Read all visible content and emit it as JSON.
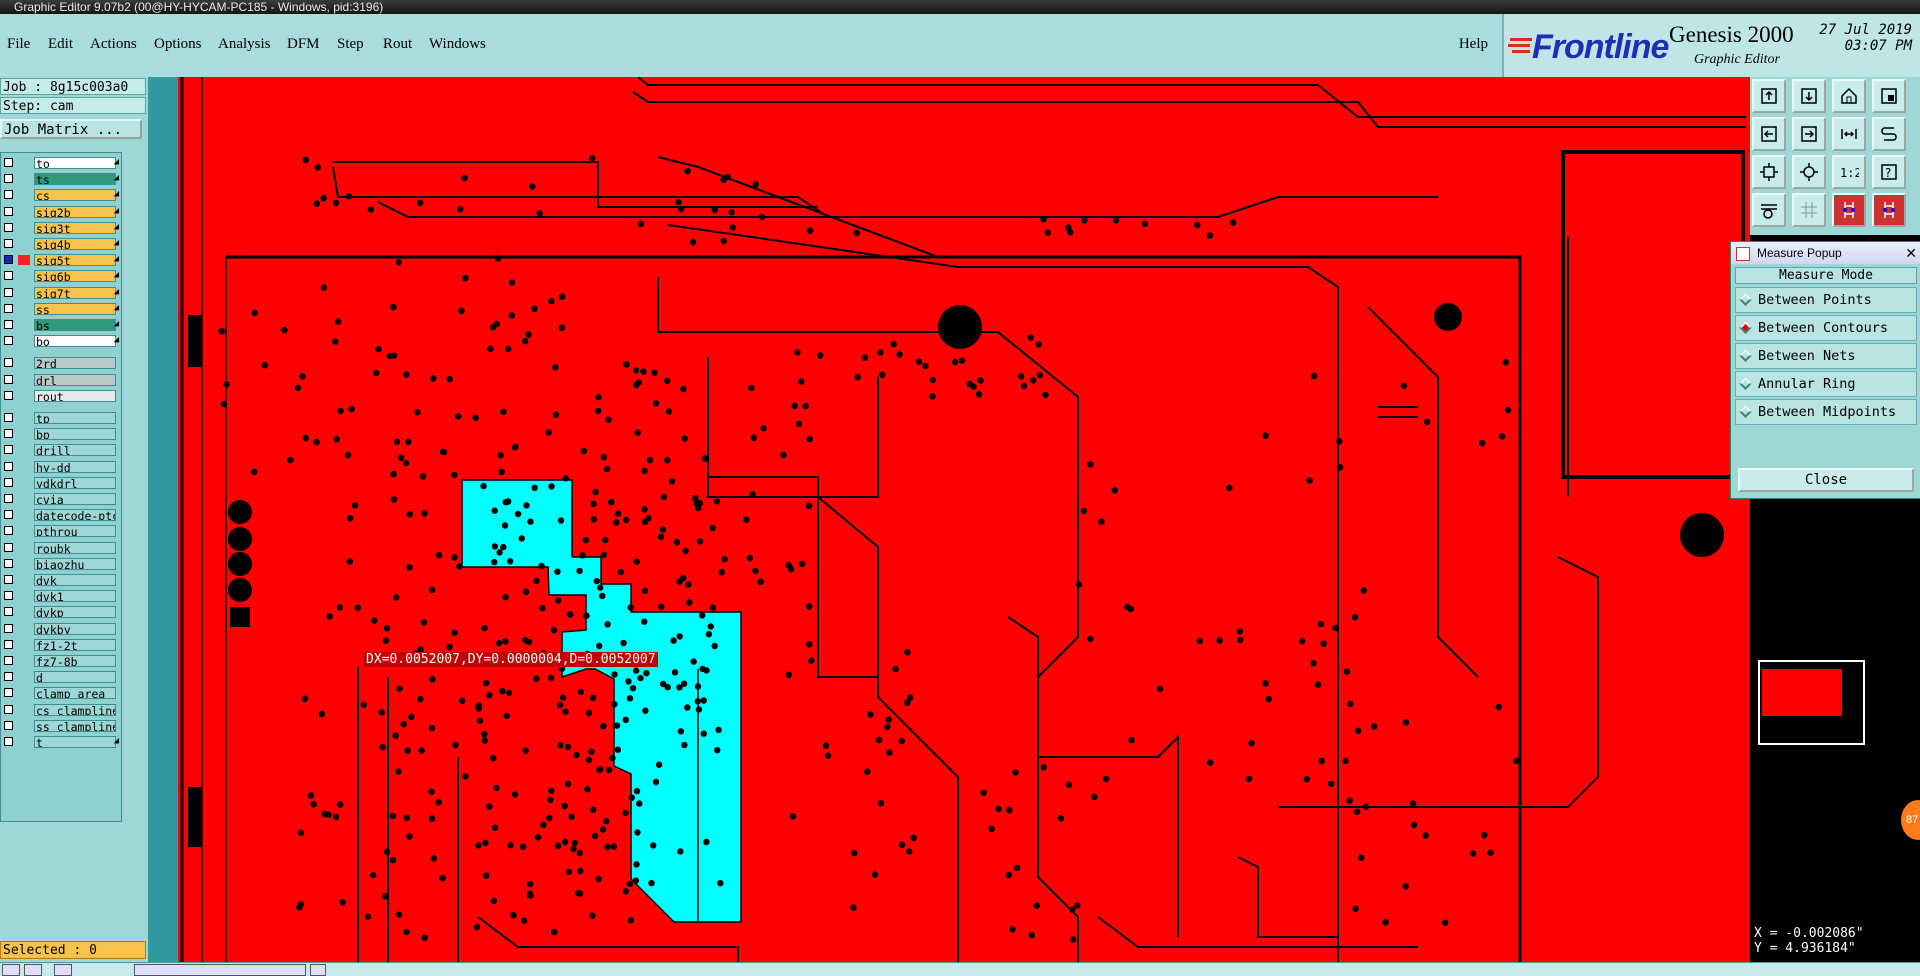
{
  "window": {
    "title": "Graphic Editor 9.07b2 (00@HY-HYCAM-PC185 - Windows, pid:3196)"
  },
  "menu": {
    "items": [
      "File",
      "Edit",
      "Actions",
      "Options",
      "Analysis",
      "DFM",
      "Step",
      "Rout",
      "Windows"
    ],
    "help": "Help"
  },
  "brand": {
    "logo": "Frontline",
    "product": "Genesis 2000",
    "subtitle": "Graphic Editor",
    "date": "27 Jul 2019",
    "time": "03:07 PM"
  },
  "job": {
    "job_line": "Job : 8g15c003a0",
    "step_line": "Step: cam",
    "matrix_button": "Job Matrix ..."
  },
  "layers": [
    {
      "name": "to",
      "color": "#ffffff"
    },
    {
      "name": "ts",
      "color": "#2e9a7a"
    },
    {
      "name": "cs",
      "color": "#f7c34b"
    },
    {
      "name": "sig2b",
      "color": "#f7c34b"
    },
    {
      "name": "sig3t",
      "color": "#f7c34b"
    },
    {
      "name": "sig4b",
      "color": "#f7c34b"
    },
    {
      "name": "sig5t",
      "color": "#f7c34b",
      "active": true
    },
    {
      "name": "sig6b",
      "color": "#f7c34b"
    },
    {
      "name": "sig7t",
      "color": "#f7c34b"
    },
    {
      "name": "ss",
      "color": "#f7c34b"
    },
    {
      "name": "bs",
      "color": "#2e9a7a"
    },
    {
      "name": "bo",
      "color": "#ffffff"
    },
    {
      "name": "2rd",
      "color": "#b8c8c8"
    },
    {
      "name": "drl",
      "color": "#b8c8c8"
    },
    {
      "name": "rout",
      "color": "#e8e8e8"
    },
    {
      "name": "tp",
      "color": "#9fd6d6"
    },
    {
      "name": "bp",
      "color": "#9fd6d6"
    },
    {
      "name": "drill",
      "color": "#9fd6d6"
    },
    {
      "name": "hy-dd",
      "color": "#9fd6d6"
    },
    {
      "name": "ydkdrl",
      "color": "#9fd6d6"
    },
    {
      "name": "cvia",
      "color": "#9fd6d6"
    },
    {
      "name": "datecode-ptc",
      "color": "#9fd6d6"
    },
    {
      "name": "pthrou",
      "color": "#9fd6d6"
    },
    {
      "name": "roubk",
      "color": "#9fd6d6"
    },
    {
      "name": "biaozhu",
      "color": "#9fd6d6"
    },
    {
      "name": "dvk",
      "color": "#9fd6d6"
    },
    {
      "name": "dvk1",
      "color": "#9fd6d6"
    },
    {
      "name": "dvkp",
      "color": "#9fd6d6"
    },
    {
      "name": "dvkby",
      "color": "#9fd6d6"
    },
    {
      "name": "fz1-2t",
      "color": "#9fd6d6"
    },
    {
      "name": "fz7-8b",
      "color": "#9fd6d6"
    },
    {
      "name": "d",
      "color": "#9fd6d6"
    },
    {
      "name": "clamp_area",
      "color": "#9fd6d6"
    },
    {
      "name": "cs_clampline",
      "color": "#9fd6d6"
    },
    {
      "name": "ss_clampline",
      "color": "#9fd6d6"
    },
    {
      "name": "t",
      "color": "#9fd6d6"
    }
  ],
  "status": {
    "selected": "Selected : 0"
  },
  "measure": {
    "readout": "DX=0.0052007,DY=0.0000004,D=0.0052007",
    "popup_title": "Measure Popup",
    "mode_header": "Measure Mode",
    "options": [
      {
        "label": "Between Points",
        "selected": false
      },
      {
        "label": "Between Contours",
        "selected": true
      },
      {
        "label": "Between Nets",
        "selected": false
      },
      {
        "label": "Annular Ring",
        "selected": false
      },
      {
        "label": "Between Midpoints",
        "selected": false
      }
    ],
    "close_button": "Close"
  },
  "coordinates": {
    "x": "X = -0.002086\"",
    "y": "Y = 4.936184\""
  },
  "badge": {
    "text": "87"
  },
  "toolbar_icons": [
    "zoom-home-icon",
    "pan-up-icon",
    "home-icon",
    "zoom-box-icon",
    "pan-left-icon",
    "pan-right-icon",
    "flip-icon",
    "snap-icon",
    "zoom-fit-icon",
    "zoom-center-icon",
    "scale-1-2-icon",
    "query-icon",
    "measure-tool-icon",
    "grid-icon",
    "net-highlight-icon",
    "net-highlight-2-icon"
  ]
}
